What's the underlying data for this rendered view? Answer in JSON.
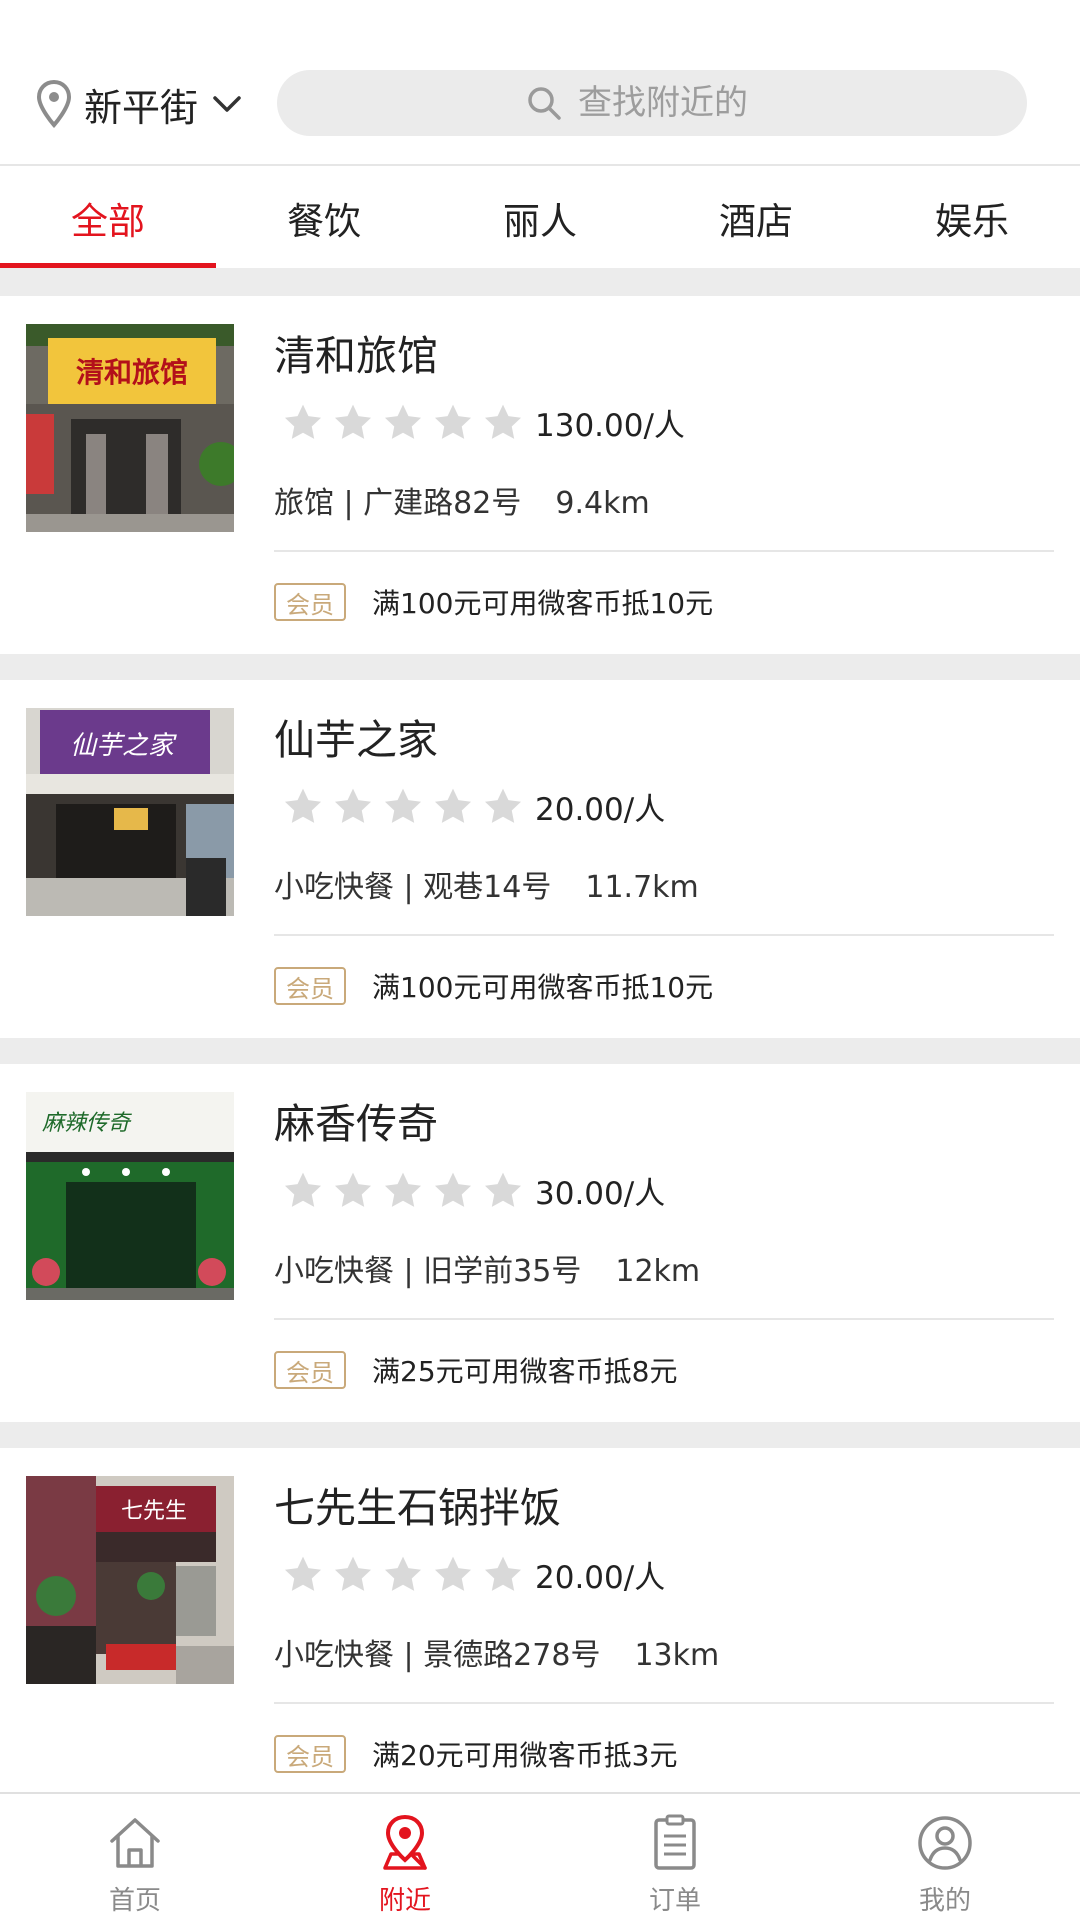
{
  "header": {
    "location": "新平街",
    "search_placeholder": "查找附近的"
  },
  "tabs": [
    {
      "label": "全部",
      "active": true
    },
    {
      "label": "餐饮",
      "active": false
    },
    {
      "label": "丽人",
      "active": false
    },
    {
      "label": "酒店",
      "active": false
    },
    {
      "label": "娱乐",
      "active": false
    }
  ],
  "shops": [
    {
      "name": "清和旅馆",
      "rating": 0,
      "price": "130.00/人",
      "category_address": "旅馆 | 广建路82号",
      "distance": "9.4km",
      "badge": "会员",
      "promo": "满100元可用微客币抵10元",
      "sign_text": "清和旅馆"
    },
    {
      "name": "仙芋之家",
      "rating": 0,
      "price": "20.00/人",
      "category_address": "小吃快餐 | 观巷14号",
      "distance": "11.7km",
      "badge": "会员",
      "promo": "满100元可用微客币抵10元",
      "sign_text": "仙芋之家"
    },
    {
      "name": "麻香传奇",
      "rating": 0,
      "price": "30.00/人",
      "category_address": "小吃快餐 | 旧学前35号",
      "distance": "12km",
      "badge": "会员",
      "promo": "满25元可用微客币抵8元",
      "sign_text": "麻辣传奇"
    },
    {
      "name": "七先生石锅拌饭",
      "rating": 0,
      "price": "20.00/人",
      "category_address": "小吃快餐 | 景德路278号",
      "distance": "13km",
      "badge": "会员",
      "promo": "满20元可用微客币抵3元",
      "sign_text": "七先生"
    }
  ],
  "bottom_nav": [
    {
      "label": "首页",
      "icon": "home-icon",
      "active": false
    },
    {
      "label": "附近",
      "icon": "location-pin-icon",
      "active": true
    },
    {
      "label": "订单",
      "icon": "order-clipboard-icon",
      "active": false
    },
    {
      "label": "我的",
      "icon": "user-profile-icon",
      "active": false
    }
  ],
  "colors": {
    "accent": "#e3141e",
    "badge": "#c9a97a",
    "star_empty": "#d9d9d9",
    "list_bg": "#ececec",
    "nav_inactive": "#8a8a8a"
  }
}
